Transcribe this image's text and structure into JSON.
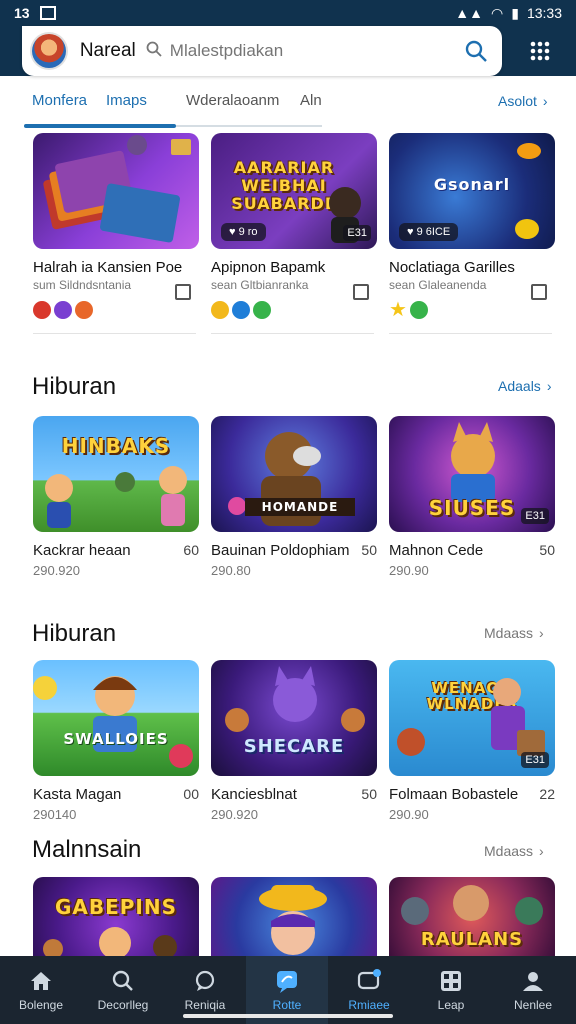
{
  "status_bar": {
    "left_text": "13",
    "time": "13:33"
  },
  "header": {
    "title": "Nareal",
    "search_placeholder": "Mlalestpdiakan",
    "icons": [
      "avatar",
      "search-icon",
      "grid-icon"
    ]
  },
  "tabs": [
    {
      "label": "Monfera",
      "active": true
    },
    {
      "label": "Imaps",
      "active": true
    },
    {
      "label": "Wderalaoanm",
      "active": false
    },
    {
      "label": "Aln",
      "active": false
    }
  ],
  "tabs_more": "Asolot",
  "section1": {
    "cards": [
      {
        "title": "Halrah ia Kansien Poe",
        "subtitle": "sum Sildndsntania",
        "thumb_text": "",
        "pill": "",
        "corner": "",
        "dots": [
          "#d9382c",
          "#7a3fd1",
          "#e8672a"
        ]
      },
      {
        "title": "Apipnon Bapamk",
        "subtitle": "sean Gltbianranka",
        "thumb_text": "AARARIAR WEIBHAI SUABARDE",
        "pill": "♥ 9 ro",
        "corner": "E31",
        "dots": [
          "#f2b81c",
          "#1f7ed8",
          "#37b34a"
        ]
      },
      {
        "title": "Noclatiaga Garilles",
        "subtitle": "sean Glaleanenda",
        "thumb_text": "Gsonarl",
        "pill": "♥ 9 6ICE",
        "corner": "",
        "dots": [
          "#f5c518",
          "#37b34a"
        ]
      }
    ]
  },
  "section2": {
    "title": "Hiburan",
    "more": "Adaals",
    "cards": [
      {
        "title": "Kackrar heaan",
        "num": "60",
        "count": "290.920",
        "thumb_text": "HINBAKS",
        "corner": ""
      },
      {
        "title": "Bauinan Poldophiam",
        "num": "50",
        "count": "290.80",
        "thumb_text": "HOMANDE",
        "corner": ""
      },
      {
        "title": "Mahnon Cede",
        "num": "50",
        "count": "290.90",
        "thumb_text": "SIUSES",
        "corner": "E31"
      }
    ]
  },
  "section3": {
    "title": "Hiburan",
    "more": "Mdaass",
    "cards": [
      {
        "title": "Kasta Magan",
        "num": "00",
        "count": "290140",
        "thumb_text": "SWALLOIES",
        "corner": ""
      },
      {
        "title": "Kanciesblnat",
        "num": "50",
        "count": "290.920",
        "thumb_text": "SHECARE",
        "corner": ""
      },
      {
        "title": "Folmaan Bobastele",
        "num": "22",
        "count": "290.90",
        "thumb_text": "WENAOR WLNADES",
        "corner": "E31"
      }
    ]
  },
  "section4": {
    "title": "Malnnsain",
    "more": "Mdaass",
    "cards": [
      {
        "thumb_text": "GABEPINS"
      },
      {
        "thumb_text": ""
      },
      {
        "thumb_text": "RAULANS"
      }
    ]
  },
  "bottom_nav": [
    {
      "label": "Bolenge",
      "icon": "home-icon",
      "active": false
    },
    {
      "label": "Decorlleg",
      "icon": "search-icon",
      "active": false
    },
    {
      "label": "Reniqia",
      "icon": "chat-icon",
      "active": false
    },
    {
      "label": "Rotte",
      "icon": "message-icon",
      "active": true
    },
    {
      "label": "Rmiaee",
      "icon": "chat-badge-icon",
      "active": false
    },
    {
      "label": "Leap",
      "icon": "apps-icon",
      "active": false
    },
    {
      "label": "Nenlee",
      "icon": "profile-icon",
      "active": false
    }
  ],
  "colors": {
    "accent": "#1d6fb0",
    "header_bg": "#10324e",
    "nav_bg": "#1b2530",
    "nav_active": "#4fb0ff"
  }
}
